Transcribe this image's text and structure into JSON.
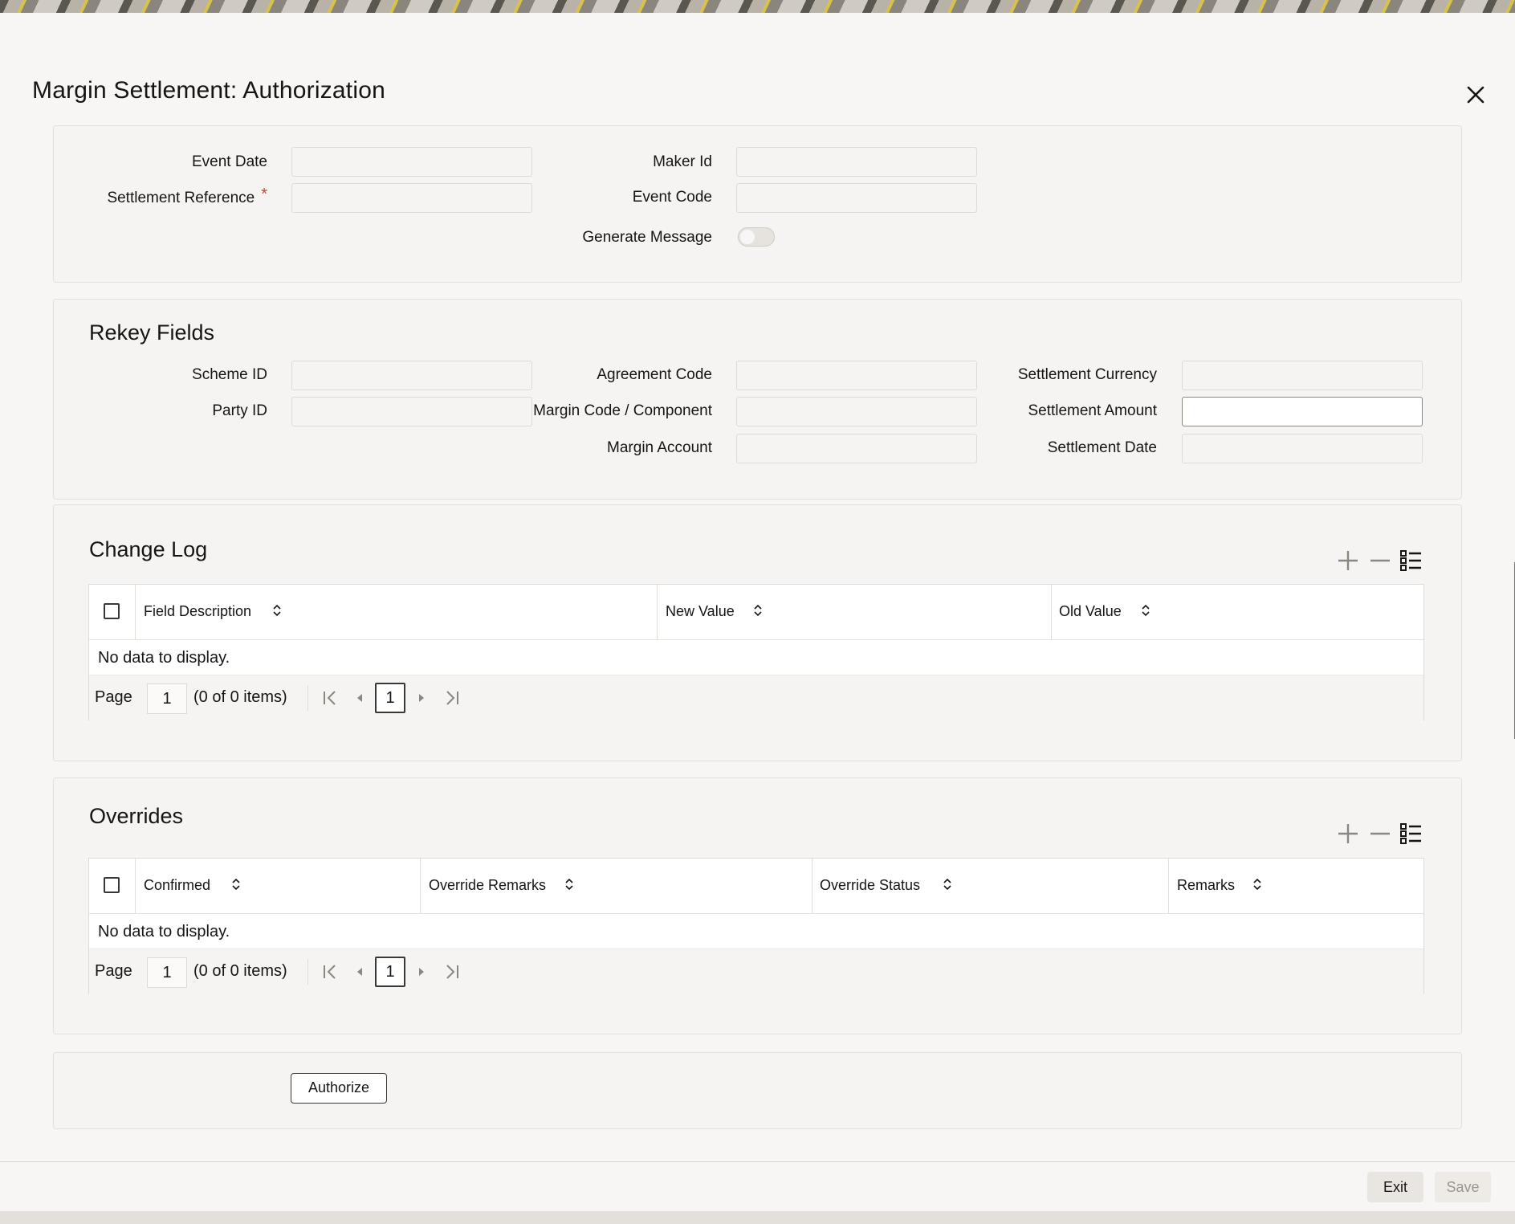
{
  "window": {
    "title": "Margin Settlement: Authorization"
  },
  "header_fields": {
    "event_date": {
      "label": "Event Date",
      "value": ""
    },
    "settlement_reference": {
      "label": "Settlement Reference",
      "required_mark": "*",
      "value": ""
    },
    "maker_id": {
      "label": "Maker Id",
      "value": ""
    },
    "event_code": {
      "label": "Event Code",
      "value": ""
    },
    "generate_message": {
      "label": "Generate Message",
      "checked": false
    }
  },
  "rekey": {
    "title": "Rekey Fields",
    "scheme_id": {
      "label": "Scheme ID",
      "value": ""
    },
    "party_id": {
      "label": "Party ID",
      "value": ""
    },
    "agreement_code": {
      "label": "Agreement Code",
      "value": ""
    },
    "margin_code_component": {
      "label": "Margin Code / Component",
      "value": ""
    },
    "margin_account": {
      "label": "Margin Account",
      "value": ""
    },
    "settlement_currency": {
      "label": "Settlement Currency",
      "value": ""
    },
    "settlement_amount": {
      "label": "Settlement Amount",
      "value": ""
    },
    "settlement_date": {
      "label": "Settlement Date",
      "value": ""
    }
  },
  "change_log": {
    "title": "Change Log",
    "columns": [
      "Field Description",
      "New Value",
      "Old Value"
    ],
    "empty_text": "No data to display.",
    "pager": {
      "label": "Page",
      "page": "1",
      "count": "(0 of 0 items)",
      "current": "1"
    }
  },
  "overrides": {
    "title": "Overrides",
    "columns": [
      "Confirmed",
      "Override Remarks",
      "Override Status",
      "Remarks"
    ],
    "empty_text": "No data to display.",
    "pager": {
      "label": "Page",
      "page": "1",
      "count": "(0 of 0 items)",
      "current": "1"
    }
  },
  "actions": {
    "authorize": "Authorize"
  },
  "footer": {
    "exit": "Exit",
    "save": "Save"
  },
  "icons": {
    "close": "close-icon",
    "add": "plus-icon",
    "remove": "minus-icon",
    "columns": "list-icon",
    "sort": "sort-icon",
    "first": "first-page-icon",
    "prev": "prev-page-icon",
    "next": "next-page-icon",
    "last": "last-page-icon"
  },
  "colors": {
    "required": "#c74634",
    "text": "#161513",
    "disabled_text": "#9a968f"
  }
}
